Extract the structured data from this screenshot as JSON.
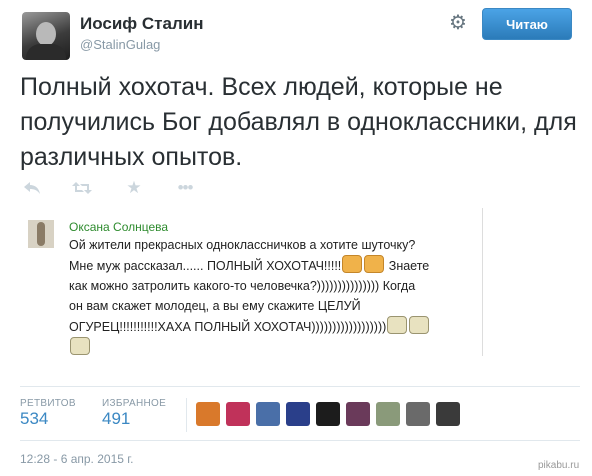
{
  "author": {
    "name": "Иосиф Сталин",
    "handle": "@StalinGulag"
  },
  "header": {
    "settings_icon": "gear-icon",
    "follow_label": "Читаю",
    "follow_color": "#3b88c3"
  },
  "tweet": {
    "text": "Полный хохотач. Всех людей, которые не получились Бог добавлял в одноклассники, для различных опытов.",
    "actions": [
      "reply-icon",
      "retweet-icon",
      "favorite-icon",
      "more-icon"
    ]
  },
  "embedded": {
    "author_name": "Оксана Солнцева",
    "line1": "Ой жители прекрасных одноклассничков а хотите шуточку?",
    "line2": "Мне муж рассказал...... ПОЛНЫЙ ХОХОТАЧ!!!!!",
    "line2b": "Знаете",
    "line3": "как можно затролить какого-то человечка?))))))))))))))) Когда",
    "line4": "он вам скажет молодец, а вы ему скажите ЦЕЛУЙ",
    "line5": "ОГУРЕЦ!!!!!!!!!!!ХАХА ПОЛНЫЙ ХОХОТАЧ))))))))))))))))))"
  },
  "stats": {
    "retweets_label": "РЕТВИТОВ",
    "retweets_count": "534",
    "favorites_label": "ИЗБРАННОЕ",
    "favorites_count": "491"
  },
  "favoriters_colors": [
    "#d9792b",
    "#c0325a",
    "#4a6fa8",
    "#2a3f8a",
    "#1c1c1c",
    "#6a3a5a",
    "#8a9a7a",
    "#6a6a6a",
    "#3a3a3a"
  ],
  "timestamp": "12:28 - 6 апр. 2015 г.",
  "watermark": "pikabu.ru"
}
